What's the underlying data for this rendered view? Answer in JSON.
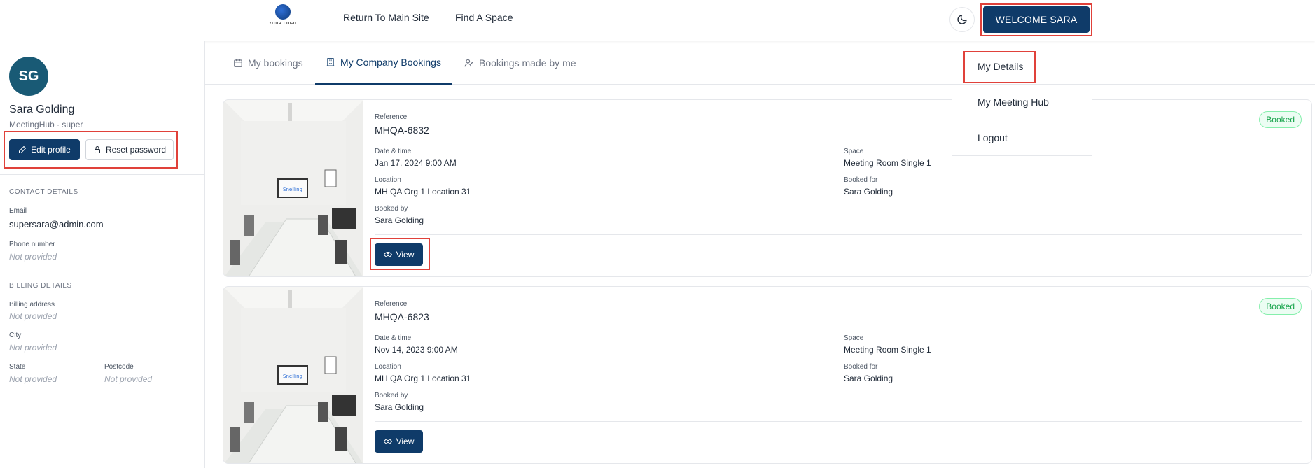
{
  "header": {
    "logo_text": "YOUR LOGO",
    "nav": [
      "Return To Main Site",
      "Find A Space"
    ],
    "welcome_label": "WELCOME SARA"
  },
  "dropdown": {
    "items": [
      "My Details",
      "My Meeting Hub",
      "Logout"
    ]
  },
  "profile": {
    "initials": "SG",
    "name": "Sara Golding",
    "subtitle": "MeetingHub · super",
    "edit_label": "Edit profile",
    "reset_label": "Reset password"
  },
  "contact": {
    "title": "CONTACT DETAILS",
    "email_label": "Email",
    "email_value": "supersara@admin.com",
    "phone_label": "Phone number",
    "phone_value": "Not provided"
  },
  "billing": {
    "title": "BILLING DETAILS",
    "address_label": "Billing address",
    "address_value": "Not provided",
    "city_label": "City",
    "city_value": "Not provided",
    "state_label": "State",
    "state_value": "Not provided",
    "postcode_label": "Postcode",
    "postcode_value": "Not provided"
  },
  "tabs": [
    "My bookings",
    "My Company Bookings",
    "Bookings made by me"
  ],
  "bookings": [
    {
      "reference_label": "Reference",
      "reference": "MHQA-6832",
      "datetime_label": "Date & time",
      "datetime": "Jan 17, 2024 9:00 AM",
      "location_label": "Location",
      "location": "MH QA Org 1 Location 31",
      "booked_by_label": "Booked by",
      "booked_by": "Sara Golding",
      "space_label": "Space",
      "space": "Meeting Room Single 1",
      "booked_for_label": "Booked for",
      "booked_for": "Sara Golding",
      "status": "Booked",
      "view_label": "View"
    },
    {
      "reference_label": "Reference",
      "reference": "MHQA-6823",
      "datetime_label": "Date & time",
      "datetime": "Nov 14, 2023 9:00 AM",
      "location_label": "Location",
      "location": "MH QA Org 1 Location 31",
      "booked_by_label": "Booked by",
      "booked_by": "Sara Golding",
      "space_label": "Space",
      "space": "Meeting Room Single 1",
      "booked_for_label": "Booked for",
      "booked_for": "Sara Golding",
      "status": "Booked",
      "view_label": "View"
    }
  ],
  "colors": {
    "primary": "#0f3b69",
    "avatar": "#195a75",
    "highlight": "#e0413a",
    "badge_green": "#16a34a"
  }
}
